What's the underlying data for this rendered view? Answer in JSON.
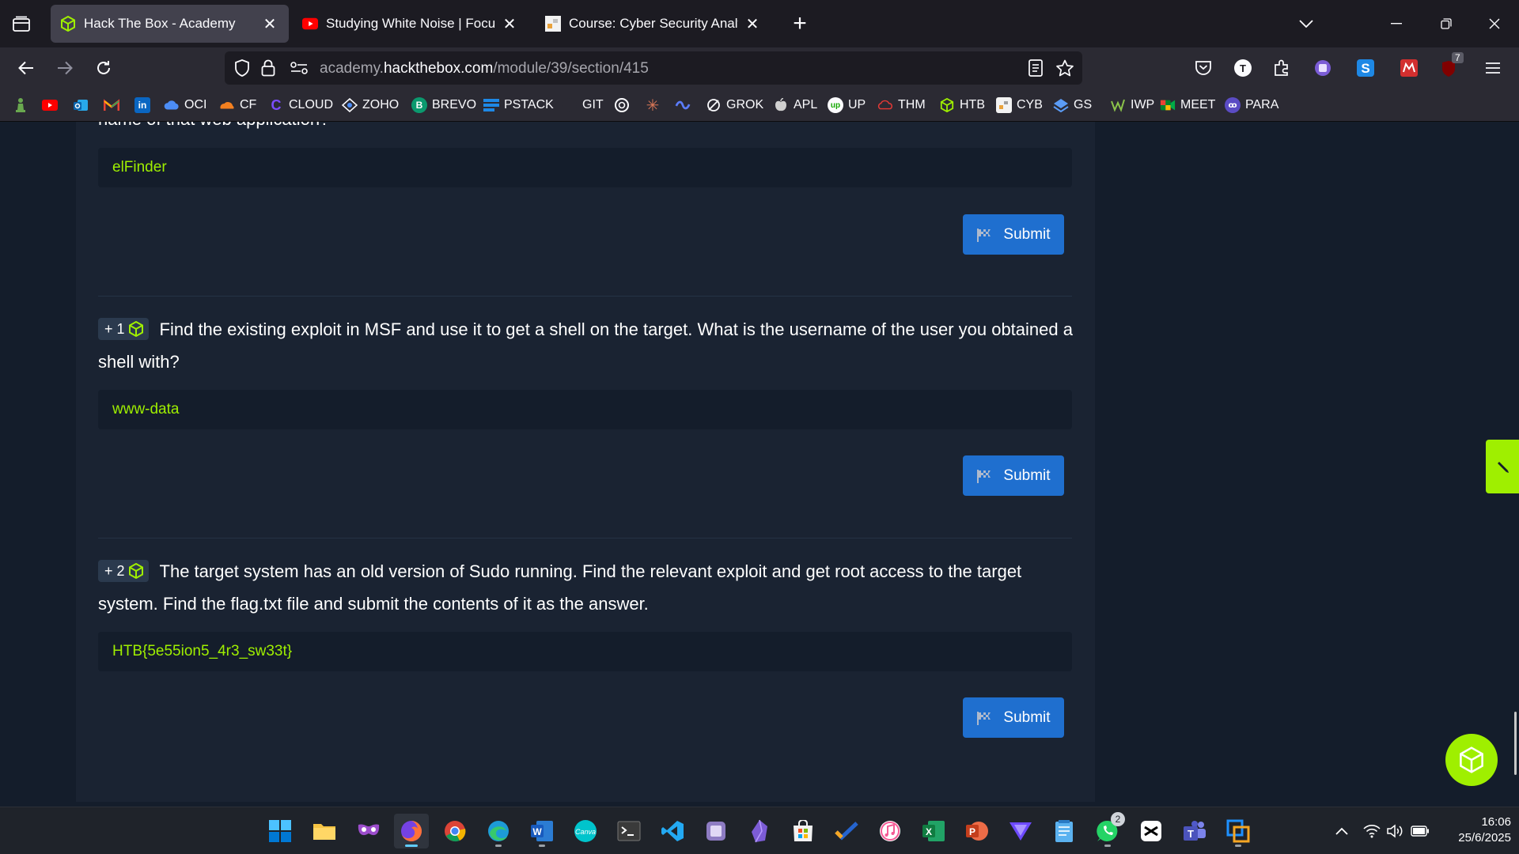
{
  "browser": {
    "tabs": [
      {
        "title": "Hack The Box - Academy",
        "active": true
      },
      {
        "title": "Studying White Noise | Focus on",
        "active": false
      },
      {
        "title": "Course: Cyber Security Analyst -",
        "active": false
      }
    ],
    "url": {
      "prefix": "academy.",
      "host": "hackthebox.com",
      "path": "/module/39/section/415"
    },
    "extension_badge": "7"
  },
  "bookmarks": [
    {
      "label": "",
      "icon": "chess-pawn-icon"
    },
    {
      "label": "",
      "icon": "youtube-icon"
    },
    {
      "label": "",
      "icon": "outlook-icon"
    },
    {
      "label": "",
      "icon": "gmail-icon"
    },
    {
      "label": "",
      "icon": "linkedin-icon"
    },
    {
      "label": "OCI",
      "icon": "cloud-icon"
    },
    {
      "label": "CF",
      "icon": "cloudflare-icon"
    },
    {
      "label": "CLOUD",
      "icon": "c-icon"
    },
    {
      "label": "ZOHO",
      "icon": "zoho-icon"
    },
    {
      "label": "BREVO",
      "icon": "brevo-icon"
    },
    {
      "label": "PSTACK",
      "icon": "stack-icon"
    },
    {
      "label": "GIT",
      "icon": "github-icon"
    },
    {
      "label": "",
      "icon": "openai-icon"
    },
    {
      "label": "",
      "icon": "claude-icon"
    },
    {
      "label": "",
      "icon": "copilot-icon"
    },
    {
      "label": "GROK",
      "icon": "grok-icon"
    },
    {
      "label": "APL",
      "icon": "apple-icon"
    },
    {
      "label": "UP",
      "icon": "upwork-icon"
    },
    {
      "label": "THM",
      "icon": "tryhackme-icon"
    },
    {
      "label": "HTB",
      "icon": "htb-cube-icon"
    },
    {
      "label": "CYB",
      "icon": "cyb-icon"
    },
    {
      "label": "GS",
      "icon": "gs-icon"
    },
    {
      "label": "IWP",
      "icon": "iwp-icon"
    },
    {
      "label": "MEET",
      "icon": "meet-icon"
    },
    {
      "label": "PARA",
      "icon": "para-icon"
    }
  ],
  "page": {
    "partial_question": "name of that web application?",
    "questions": [
      {
        "points": "",
        "text": "",
        "answer": "elFinder"
      },
      {
        "points": "+ 1",
        "text": "Find the existing exploit in MSF and use it to get a shell on the target. What is the username of the user you obtained a shell with?",
        "answer": "www-data"
      },
      {
        "points": "+ 2",
        "text": "The target system has an old version of Sudo running. Find the relevant exploit and get root access to the target system. Find the flag.txt file and submit the contents of it as the answer.",
        "answer": "HTB{5e55ion5_4r3_sw33t}"
      }
    ],
    "submit_label": "Submit",
    "accent": "#9fef00",
    "button_color": "#1f6fcf"
  },
  "taskbar": {
    "whatsapp_badge": "2",
    "time": "16:06",
    "date": "25/6/2025"
  }
}
